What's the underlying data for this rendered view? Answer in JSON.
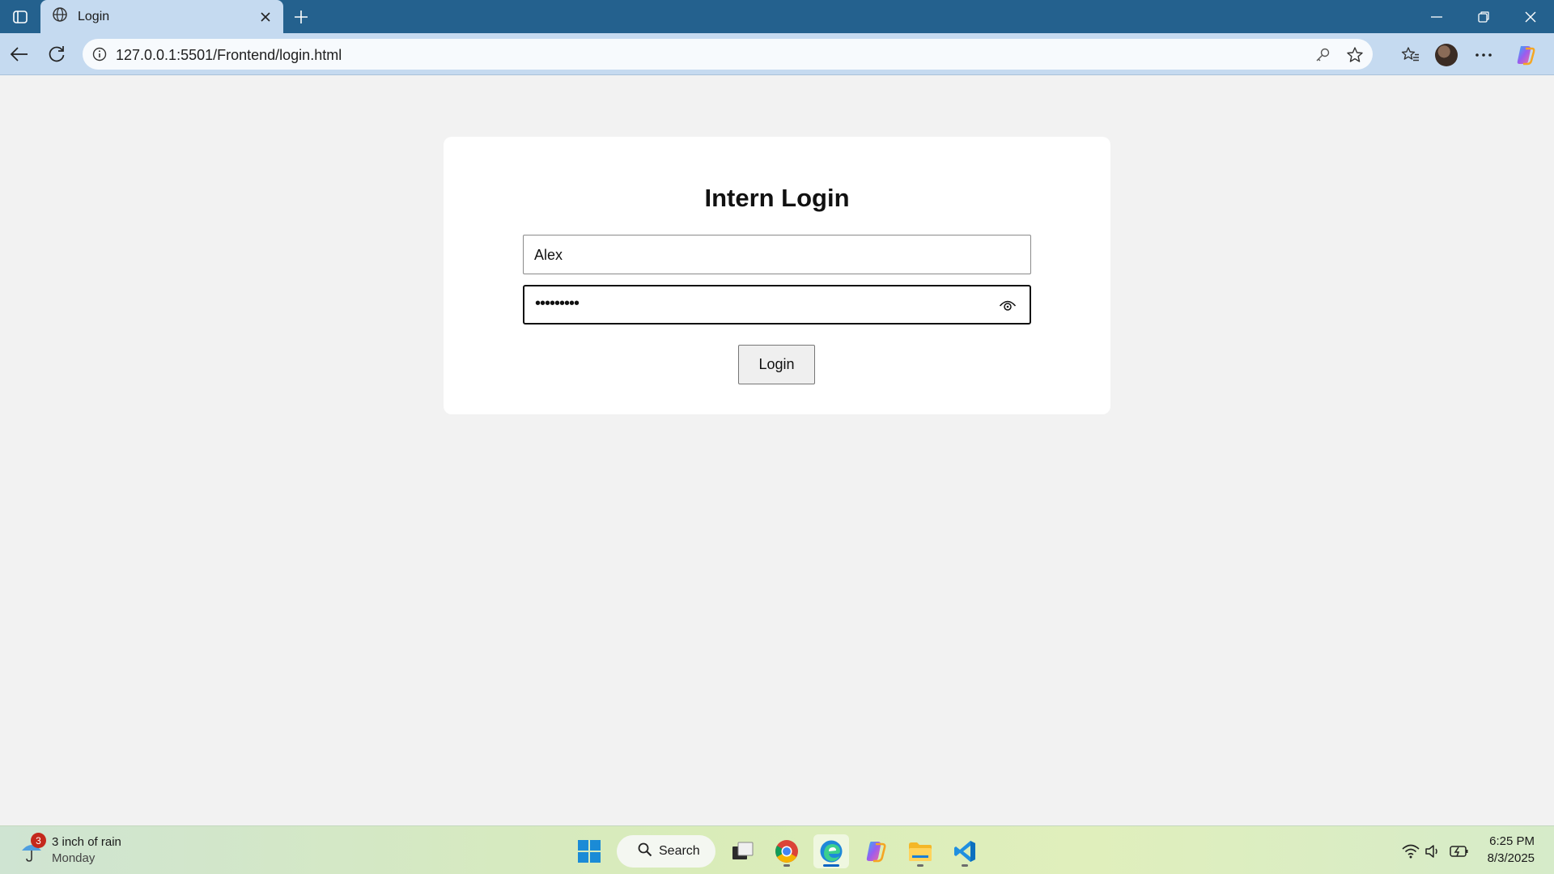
{
  "browser": {
    "tab_title": "Login",
    "url": "127.0.0.1:5501/Frontend/login.html"
  },
  "page": {
    "title": "Intern Login",
    "username_value": "Alex",
    "password_value": "•••••••••",
    "login_label": "Login"
  },
  "taskbar": {
    "weather_badge": "3",
    "weather_text": "3 inch of rain",
    "weather_day": "Monday",
    "search_label": "Search",
    "time": "6:25 PM",
    "date": "8/3/2025"
  }
}
